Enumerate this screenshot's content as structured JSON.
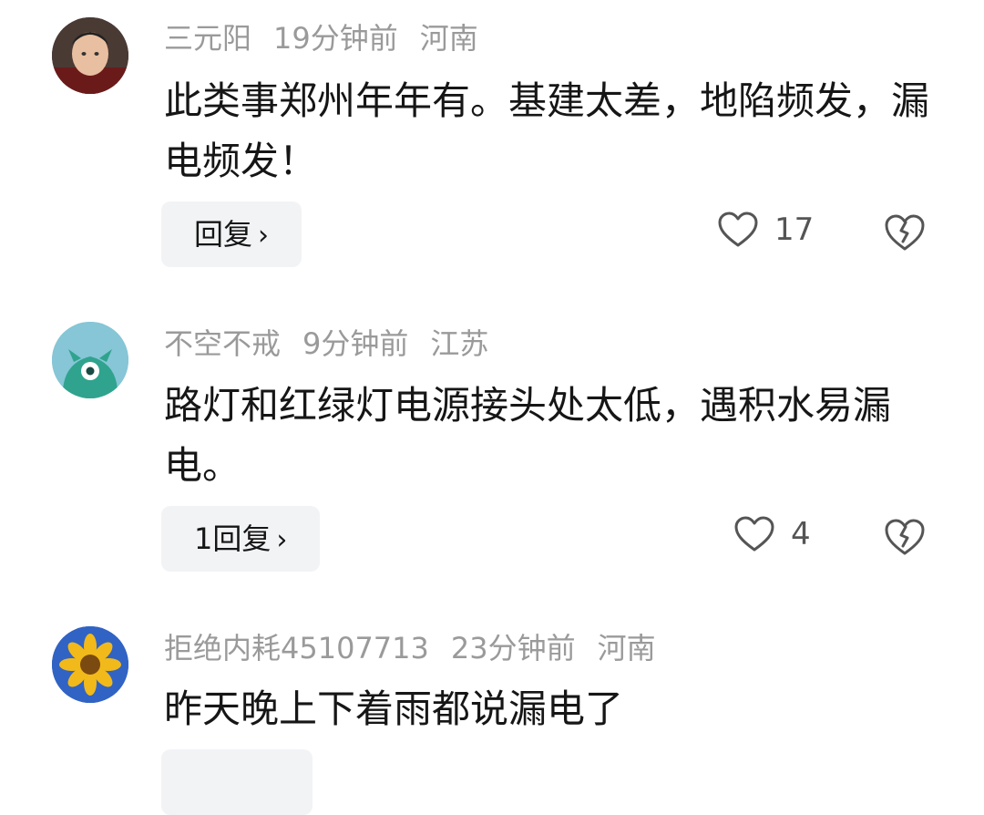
{
  "comments": [
    {
      "username": "三元阳",
      "time": "19分钟前",
      "location": "河南",
      "text": "此类事郑州年年有。基建太差，地陷频发，漏电频发！",
      "reply_label": "回复",
      "likes": "17",
      "avatar_icon": "user-photo-avatar"
    },
    {
      "username": "不空不戒",
      "time": "9分钟前",
      "location": "江苏",
      "text": "路灯和红绿灯电源接头处太低，遇积水易漏电。",
      "reply_label": "1回复",
      "likes": "4",
      "avatar_icon": "teal-monster-avatar"
    },
    {
      "username": "拒绝内耗45107713",
      "time": "23分钟前",
      "location": "河南",
      "text": "昨天晚上下着雨都说漏电了",
      "avatar_icon": "sunflower-avatar"
    }
  ],
  "icons": {
    "like": "heart-outline-icon",
    "dislike": "broken-heart-icon",
    "chevron": "chevron-right-icon"
  },
  "colors": {
    "meta_text": "#9a9a9a",
    "body_text": "#161616",
    "reply_bg": "#f1f3f5",
    "icon_gray": "#555555"
  }
}
